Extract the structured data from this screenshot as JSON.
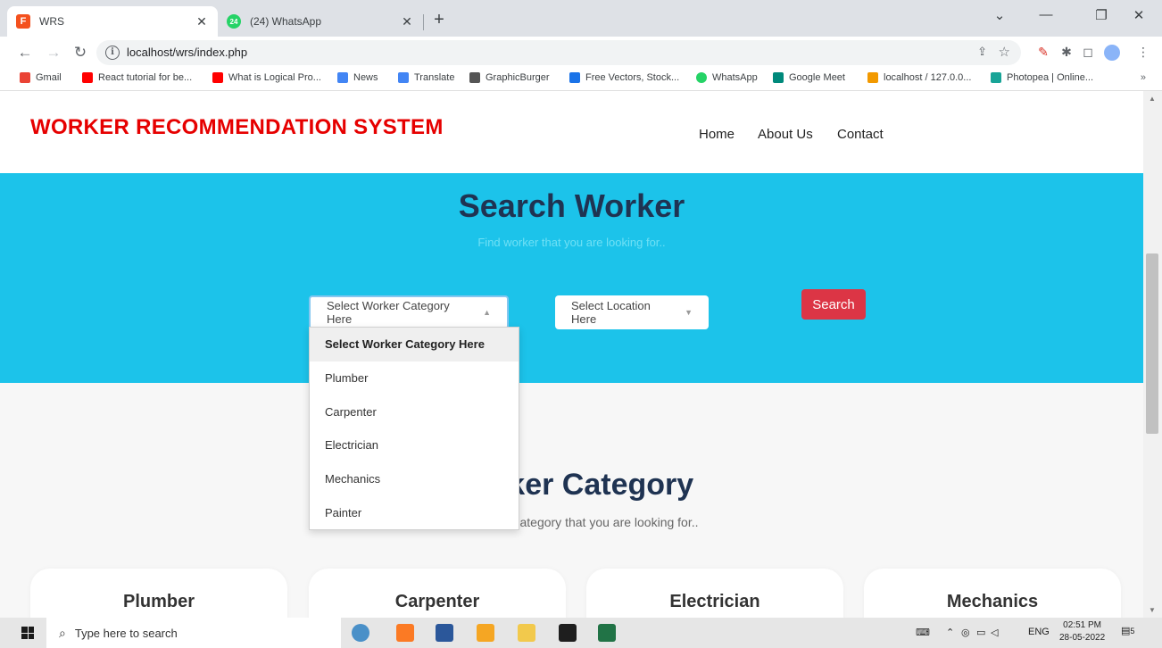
{
  "browser": {
    "tabs": [
      {
        "title": "WRS",
        "favicon": "F",
        "favicon_color": "#f4511e",
        "active": true
      },
      {
        "title": "(24) WhatsApp",
        "favicon": "24",
        "favicon_color": "#25d366",
        "active": false
      }
    ],
    "url": "localhost/wrs/index.php",
    "bookmarks": [
      {
        "label": "Gmail",
        "color": "#ea4335"
      },
      {
        "label": "React tutorial for be...",
        "color": "#ff0000"
      },
      {
        "label": "What is Logical Pro...",
        "color": "#ff0000"
      },
      {
        "label": "News",
        "color": "#4285f4"
      },
      {
        "label": "Translate",
        "color": "#4285f4"
      },
      {
        "label": "GraphicBurger",
        "color": "#555555"
      },
      {
        "label": "Free Vectors, Stock...",
        "color": "#1a73e8"
      },
      {
        "label": "WhatsApp",
        "color": "#25d366"
      },
      {
        "label": "Google Meet",
        "color": "#00897b"
      },
      {
        "label": "localhost / 127.0.0...",
        "color": "#f29900"
      },
      {
        "label": "Photopea | Online...",
        "color": "#18a497"
      }
    ],
    "bookmarks_more": "»"
  },
  "site": {
    "brand": "WORKER RECOMMENDATION SYSTEM",
    "nav": [
      "Home",
      "About Us",
      "Contact"
    ],
    "hero": {
      "title": "Search Worker",
      "subtitle": "Find worker that you are looking for..",
      "category_select": "Select Worker Category Here",
      "location_select": "Select Location Here",
      "search_button": "Search"
    },
    "dropdown_options": [
      "Select Worker Category Here",
      "Plumber",
      "Carpenter",
      "Electrician",
      "Mechanics",
      "Painter"
    ],
    "section": {
      "title": "Worker Category",
      "subtitle": "Find worker category that you are looking for.."
    },
    "cards": [
      "Plumber",
      "Carpenter",
      "Electrician",
      "Mechanics"
    ]
  },
  "taskbar": {
    "search_placeholder": "Type here to search",
    "lang": "ENG",
    "time": "02:51 PM",
    "date": "28-05-2022",
    "notifications": "5"
  },
  "colors": {
    "brand_red": "#e60000",
    "hero_bg": "#1cc3ea",
    "title_navy": "#1f3352",
    "button_red": "#dc3545"
  }
}
